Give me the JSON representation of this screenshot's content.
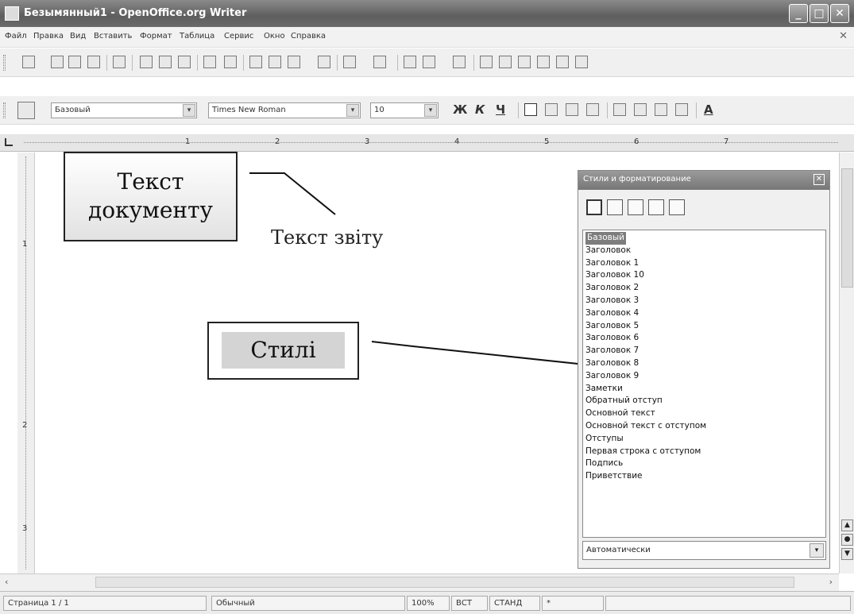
{
  "window": {
    "title": "Безымянный1 - OpenOffice.org Writer",
    "min_glyph": "_",
    "max_glyph": "□",
    "close_glyph": "✕"
  },
  "menu": {
    "items": [
      "Файл",
      "Правка",
      "Вид",
      "Вставить",
      "Формат",
      "Таблица",
      "Сервис",
      "Окно",
      "Справка"
    ],
    "close_glyph": "✕"
  },
  "format_toolbar": {
    "style_value": "Базовый",
    "font_value": "Times New Roman",
    "size_value": "10",
    "dropdown_glyph": "▾",
    "bold": "Ж",
    "italic": "К",
    "underline": "Ч",
    "font_color": "A"
  },
  "ruler": {
    "numbers": [
      "1",
      "2",
      "3",
      "4",
      "5",
      "6",
      "7"
    ],
    "vertical_numbers": [
      "1",
      "2",
      "3"
    ]
  },
  "document": {
    "callout_document": "Текст документу",
    "report_text": "Текст звіту",
    "callout_styles": "Стилі"
  },
  "styles_panel": {
    "title": "Стили и форматирование",
    "close_glyph": "✕",
    "items": [
      "Базовый",
      "Заголовок",
      "Заголовок 1",
      "Заголовок 10",
      "Заголовок 2",
      "Заголовок 3",
      "Заголовок 4",
      "Заголовок 5",
      "Заголовок 6",
      "Заголовок 7",
      "Заголовок 8",
      "Заголовок 9",
      "Заметки",
      "Обратный отступ",
      "Основной текст",
      "Основной текст с отступом",
      "Отступы",
      "Первая строка с отступом",
      "Подпись",
      "Приветствие"
    ],
    "selected_index": 0,
    "filter_value": "Автоматически",
    "dropdown_glyph": "▾"
  },
  "status": {
    "page": "Страница 1 / 1",
    "style": "Обычный",
    "zoom": "100%",
    "mode1": "ВСТ",
    "mode2": "СТАНД",
    "selection": "*"
  },
  "colors": {
    "titlebar": "#6a6a6a",
    "selection": "#7d7d7d",
    "callout_fill": "#d4d4d4"
  }
}
